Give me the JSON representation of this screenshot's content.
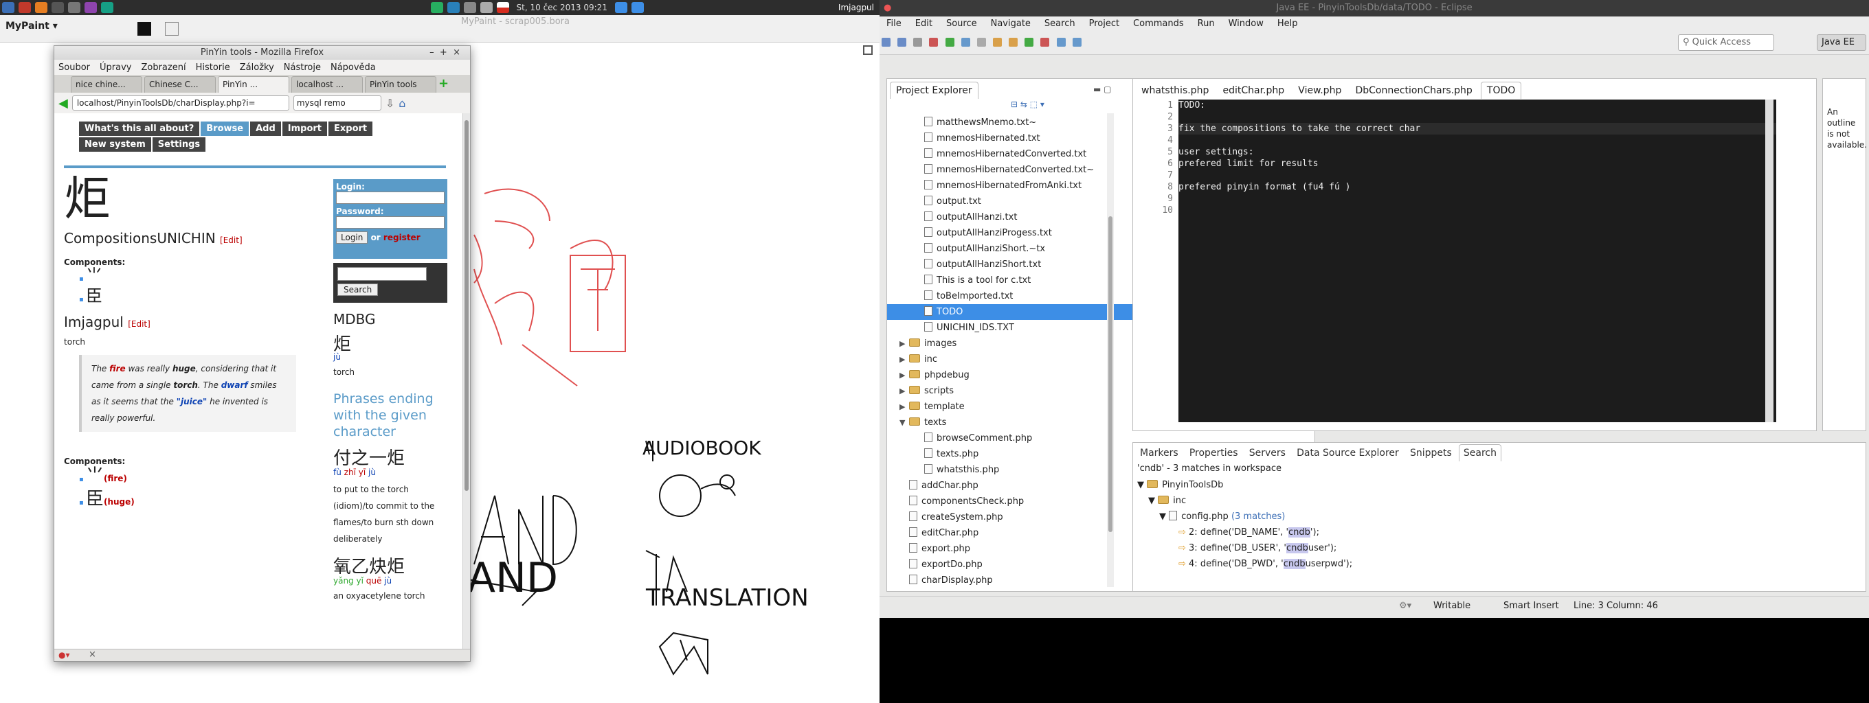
{
  "panel": {
    "clock": "St, 10 čec 2013 09:21",
    "right_app": "Imjagpul"
  },
  "mypaint": {
    "window_title": "MyPaint - scrap005.bora",
    "menu_label": "MyPaint",
    "sketch_words": [
      "AUDIOBOOK",
      "TRANSLATION",
      "AND"
    ]
  },
  "firefox": {
    "title": "PinYin tools - Mozilla Firefox",
    "menu": [
      "Soubor",
      "Úpravy",
      "Zobrazení",
      "Historie",
      "Záložky",
      "Nástroje",
      "Nápověda"
    ],
    "tabs": [
      "nice chine...",
      "Chinese C...",
      "PinYin ...",
      "localhost ...",
      "PinYin tools"
    ],
    "url": "localhost/PinyinToolsDb/charDisplay.php?i=",
    "search": "mysql remo"
  },
  "page": {
    "nav": [
      "What's this all about?",
      "Browse",
      "Add",
      "Import",
      "Export",
      "New system",
      "Settings"
    ],
    "char": "炬",
    "compositions": "CompositionsUNICHIN",
    "edit": "[Edit]",
    "components_label": "Components:",
    "components_top": [
      "⺌",
      "⾂"
    ],
    "imjagpul_heading": "Imjagpul",
    "imjagpul_edit": "[Edit]",
    "meaning": "torch",
    "story": {
      "s1": "The ",
      "fire": "fire",
      "s2": " was really ",
      "huge": "huge",
      "s3": ", considering that it came from a single ",
      "torch": "torch",
      "s4": ". The ",
      "dwarf": "dwarf",
      "s5": " smiles as it seems that the ",
      "juice": "\"juice\"",
      "s6": " he invented is really powerful."
    },
    "components_bottom": [
      {
        "glyph": "⺌",
        "label": "(fire)"
      },
      {
        "glyph": "⾂",
        "label": "(huge)"
      }
    ],
    "login": {
      "login_label": "Login:",
      "password_label": "Password:",
      "login_button": "Login",
      "or": "or",
      "register": "register",
      "search_button": "Search"
    },
    "mdbg": {
      "heading": "MDBG",
      "char": "炬",
      "pinyin": "jù",
      "meaning": "torch"
    },
    "phrases_heading": "Phrases ending with the given character",
    "phrases": [
      {
        "hanzi": "付之一炬",
        "pinyin": [
          "fù",
          "zhī",
          "yī",
          "jù"
        ],
        "meaning": "to put to the torch (idiom)/to commit to the flames/to burn sth down deliberately"
      },
      {
        "hanzi": "氧乙炔炬",
        "pinyin": [
          "yǎng",
          "yǐ",
          "quē",
          "jù"
        ],
        "meaning": "an oxyacetylene torch"
      }
    ]
  },
  "eclipse": {
    "title": "Java EE - PinyinToolsDb/data/TODO - Eclipse",
    "menu": [
      "File",
      "Edit",
      "Source",
      "Navigate",
      "Search",
      "Project",
      "Commands",
      "Run",
      "Window",
      "Help"
    ],
    "quick_access": "Quick Access",
    "perspective": "Java EE",
    "project_explorer": "Project Explorer",
    "editor_tabs": [
      "whatsthis.php",
      "editChar.php",
      "View.php",
      "DbConnectionChars.php",
      "TODO"
    ],
    "outline_text": "An outline is not available.",
    "tree": [
      {
        "name": "matthewsMnemo.txt~",
        "type": "file",
        "indent": 2
      },
      {
        "name": "mnemosHibernated.txt",
        "type": "file",
        "indent": 2
      },
      {
        "name": "mnemosHibernatedConverted.txt",
        "type": "file",
        "indent": 2
      },
      {
        "name": "mnemosHibernatedConverted.txt~",
        "type": "file",
        "indent": 2
      },
      {
        "name": "mnemosHibernatedFromAnki.txt",
        "type": "file",
        "indent": 2
      },
      {
        "name": "output.txt",
        "type": "file",
        "indent": 2
      },
      {
        "name": "outputAllHanzi.txt",
        "type": "file",
        "indent": 2
      },
      {
        "name": "outputAllHanziProgess.txt",
        "type": "file",
        "indent": 2
      },
      {
        "name": "outputAllHanziShort.~tx",
        "type": "file",
        "indent": 2
      },
      {
        "name": "outputAllHanziShort.txt",
        "type": "file",
        "indent": 2
      },
      {
        "name": "This is a tool for c.txt",
        "type": "file",
        "indent": 2
      },
      {
        "name": "toBeImported.txt",
        "type": "file",
        "indent": 2
      },
      {
        "name": "TODO",
        "type": "file",
        "indent": 2,
        "selected": true
      },
      {
        "name": "UNICHIN_IDS.TXT",
        "type": "file",
        "indent": 2
      },
      {
        "name": "images",
        "type": "folder",
        "indent": 1,
        "arrow": "▶"
      },
      {
        "name": "inc",
        "type": "folder",
        "indent": 1,
        "arrow": "▶"
      },
      {
        "name": "phpdebug",
        "type": "folder",
        "indent": 1,
        "arrow": "▶"
      },
      {
        "name": "scripts",
        "type": "folder",
        "indent": 1,
        "arrow": "▶"
      },
      {
        "name": "template",
        "type": "folder",
        "indent": 1,
        "arrow": "▶"
      },
      {
        "name": "texts",
        "type": "folder",
        "indent": 1,
        "arrow": "▼"
      },
      {
        "name": "browseComment.php",
        "type": "file",
        "indent": 2
      },
      {
        "name": "texts.php",
        "type": "file",
        "indent": 2
      },
      {
        "name": "whatsthis.php",
        "type": "file",
        "indent": 2
      },
      {
        "name": "addChar.php",
        "type": "file",
        "indent": 1
      },
      {
        "name": "componentsCheck.php",
        "type": "file",
        "indent": 1
      },
      {
        "name": "createSystem.php",
        "type": "file",
        "indent": 1
      },
      {
        "name": "editChar.php",
        "type": "file",
        "indent": 1
      },
      {
        "name": "export.php",
        "type": "file",
        "indent": 1
      },
      {
        "name": "exportDo.php",
        "type": "file",
        "indent": 1
      },
      {
        "name": "charDisplay.php",
        "type": "file",
        "indent": 1
      }
    ],
    "code_lines": [
      "TODO:",
      "",
      "fix the compositions to take the correct char",
      "",
      "user settings:",
      "prefered limit for results",
      "",
      "prefered pinyin format (fu4 fú )",
      "",
      ""
    ],
    "bottom_tabs": [
      "Markers",
      "Properties",
      "Servers",
      "Data Source Explorer",
      "Snippets",
      "Search"
    ],
    "search_summary": "'cndb' - 3 matches in workspace",
    "search_tree": {
      "project": "PinyinToolsDb",
      "folder": "inc",
      "file": "config.php",
      "matches_label": "(3 matches)",
      "matches": [
        {
          "pre": "2: define('DB_NAME', '",
          "hit": "cndb",
          "post": "');"
        },
        {
          "pre": "3: define('DB_USER', '",
          "hit": "cndb",
          "post": "user');"
        },
        {
          "pre": "4: define('DB_PWD', '",
          "hit": "cndb",
          "post": "userpwd');"
        }
      ]
    },
    "status": {
      "writable": "Writable",
      "insert": "Smart Insert",
      "position": "Line: 3 Column: 46"
    }
  }
}
